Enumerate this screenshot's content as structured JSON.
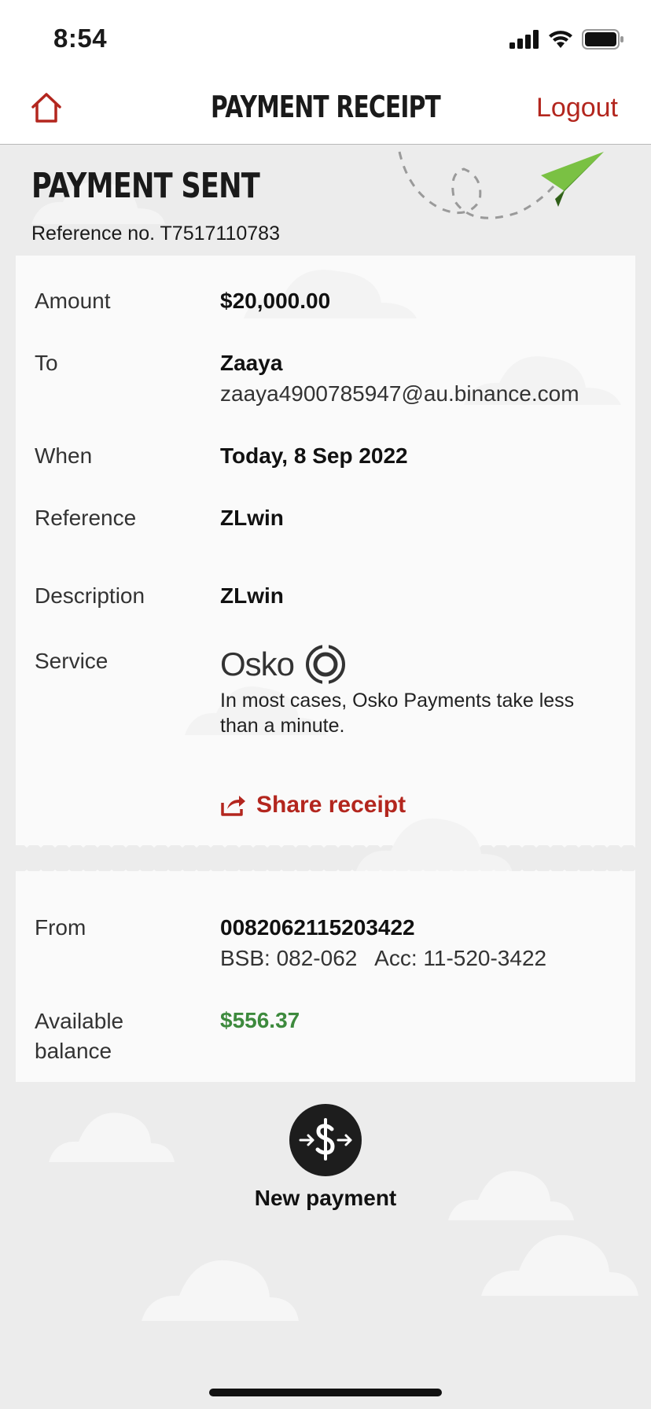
{
  "status_bar": {
    "time": "8:54"
  },
  "nav": {
    "title": "PAYMENT RECEIPT",
    "logout_label": "Logout"
  },
  "hero": {
    "title": "PAYMENT SENT",
    "reference": "Reference no. T7517110783"
  },
  "details": {
    "amount": {
      "label": "Amount",
      "value": "$20,000.00"
    },
    "to": {
      "label": "To",
      "name": "Zaaya",
      "email": "zaaya4900785947@au.binance.com"
    },
    "when": {
      "label": "When",
      "value": "Today, 8 Sep 2022"
    },
    "reference": {
      "label": "Reference",
      "value": "ZLwin"
    },
    "description": {
      "label": "Description",
      "value": "ZLwin"
    },
    "service": {
      "label": "Service",
      "logo_text": "Osko",
      "note": "In most cases, Osko Payments take less than a minute."
    },
    "share_label": "Share receipt"
  },
  "account": {
    "from": {
      "label": "From",
      "number": "0082062115203422",
      "bsb_acc": "BSB: 082-062   Acc: 11-520-3422"
    },
    "balance": {
      "label": "Available balance",
      "value": "$556.37"
    }
  },
  "new_payment_label": "New payment",
  "colors": {
    "brand_red": "#b3261e",
    "balance_green": "#3d8a3d",
    "plane_green": "#7ac143"
  },
  "icons": {
    "home": "home-icon",
    "share": "share-icon",
    "new_payment": "dollar-transfer-icon",
    "osko": "osko-icon"
  }
}
